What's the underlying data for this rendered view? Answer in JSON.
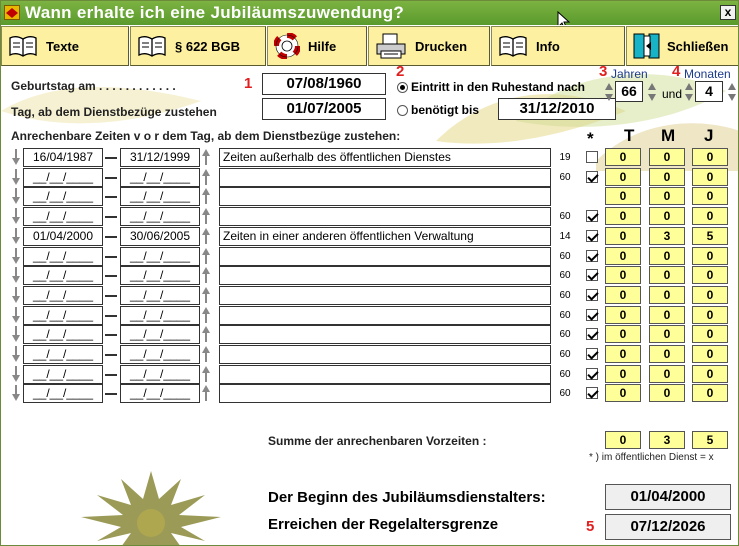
{
  "window": {
    "title": "Wann erhalte ich eine Jubiläumszuwendung?",
    "close_label": "x"
  },
  "toolbar": [
    {
      "label": "Texte",
      "icon": "book-icon"
    },
    {
      "label": "§ 622 BGB",
      "icon": "book-icon"
    },
    {
      "label": "Hilfe",
      "icon": "lifebuoy-icon"
    },
    {
      "label": "Drucken",
      "icon": "printer-icon"
    },
    {
      "label": "Info",
      "icon": "book-icon"
    },
    {
      "label": "Schließen",
      "icon": "exit-door-icon"
    }
  ],
  "form": {
    "birthday_label": "Geburtstag am . . . . . . . . . . . .",
    "birthday_value": "07/08/1960",
    "salary_label": "Tag, ab dem Dienstbezüge zustehen",
    "salary_value": "01/07/2005",
    "marker1": "1",
    "marker2": "2",
    "marker3": "3",
    "marker4": "4",
    "marker5": "5",
    "option_retirement": "Eintritt in den Ruhestand nach",
    "option_needed": "benötigt bis",
    "needed_value": "31/12/2010",
    "years_label": "Jahren",
    "years_value": "66",
    "and_label": "und",
    "months_label": "Monaten",
    "months_value": "4"
  },
  "periods": {
    "header": "Anrechenbare Zeiten   v o r   dem Tag, ab dem Dienstbezüge zustehen:",
    "star": "*",
    "col_t": "T",
    "col_m": "M",
    "col_j": "J",
    "rows": [
      {
        "from": "16/04/1987",
        "to": "31/12/1999",
        "desc": "Zeiten außerhalb des öffentlichen Dienstes",
        "mult": "19",
        "checked": false,
        "t": "0",
        "m": "0",
        "j": "0"
      },
      {
        "from": "__/__/____",
        "to": "__/__/____",
        "desc": "",
        "mult": "60",
        "checked": true,
        "t": "0",
        "m": "0",
        "j": "0"
      },
      {
        "from": "__/__/____",
        "to": "__/__/____",
        "desc": "",
        "mult": "",
        "checked": null,
        "t": "0",
        "m": "0",
        "j": "0"
      },
      {
        "from": "__/__/____",
        "to": "__/__/____",
        "desc": "",
        "mult": "60",
        "checked": true,
        "t": "0",
        "m": "0",
        "j": "0"
      },
      {
        "from": "01/04/2000",
        "to": "30/06/2005",
        "desc": "Zeiten in einer anderen öffentlichen Verwaltung",
        "mult": "14",
        "checked": true,
        "t": "0",
        "m": "3",
        "j": "5"
      },
      {
        "from": "__/__/____",
        "to": "__/__/____",
        "desc": "",
        "mult": "60",
        "checked": true,
        "t": "0",
        "m": "0",
        "j": "0"
      },
      {
        "from": "__/__/____",
        "to": "__/__/____",
        "desc": "",
        "mult": "60",
        "checked": true,
        "t": "0",
        "m": "0",
        "j": "0"
      },
      {
        "from": "__/__/____",
        "to": "__/__/____",
        "desc": "",
        "mult": "60",
        "checked": true,
        "t": "0",
        "m": "0",
        "j": "0"
      },
      {
        "from": "__/__/____",
        "to": "__/__/____",
        "desc": "",
        "mult": "60",
        "checked": true,
        "t": "0",
        "m": "0",
        "j": "0"
      },
      {
        "from": "__/__/____",
        "to": "__/__/____",
        "desc": "",
        "mult": "60",
        "checked": true,
        "t": "0",
        "m": "0",
        "j": "0"
      },
      {
        "from": "__/__/____",
        "to": "__/__/____",
        "desc": "",
        "mult": "60",
        "checked": true,
        "t": "0",
        "m": "0",
        "j": "0"
      },
      {
        "from": "__/__/____",
        "to": "__/__/____",
        "desc": "",
        "mult": "60",
        "checked": true,
        "t": "0",
        "m": "0",
        "j": "0"
      },
      {
        "from": "__/__/____",
        "to": "__/__/____",
        "desc": "",
        "mult": "60",
        "checked": true,
        "t": "0",
        "m": "0",
        "j": "0"
      }
    ],
    "sum_label": "Summe der anrechenbaren Vorzeiten :",
    "sum_t": "0",
    "sum_m": "3",
    "sum_j": "5",
    "footnote": "* ) im öffentlichen Dienst = x"
  },
  "results": {
    "begin_label": "Der Beginn des Jubiläumsdienstalters:",
    "begin_value": "01/04/2000",
    "retire_label": "Erreichen der Regelaltersgrenze",
    "retire_value": "07/12/2026"
  },
  "colors": {
    "titlebar": "#6aa535",
    "button": "#fdf0a0",
    "yellow_field": "#ffff99",
    "marker": "#e02020"
  }
}
